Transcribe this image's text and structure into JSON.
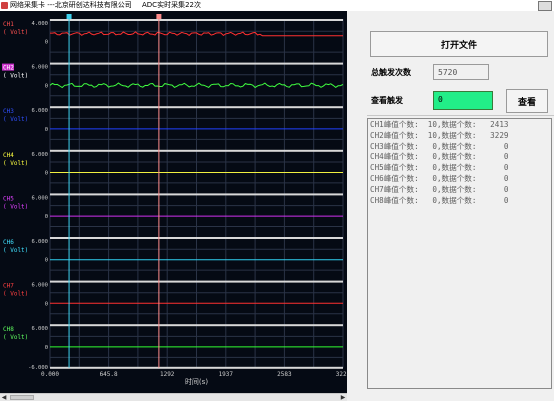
{
  "window": {
    "title": "网络采集卡 ---北京研创达科技有限公司",
    "subtitle": "ADC实时采集22次"
  },
  "chart_data": {
    "type": "line",
    "xlabel": "时间(s)",
    "xlim": [
      0.0,
      3229
    ],
    "x_ticks": [
      "0.000",
      "645.8",
      "1292",
      "1937",
      "2583",
      "3229"
    ],
    "cursors": [
      {
        "color": "#3fd3f0",
        "x": 210
      },
      {
        "color": "#ff8c8c",
        "x": 1200
      }
    ],
    "grid": true,
    "channels": [
      {
        "name": "CH1",
        "unit": "( Volt)",
        "name_color": "#ff5050",
        "unit_color": "#ff5050",
        "line_color": "#ff3030",
        "ymax": "4.000",
        "ymin": "",
        "trace": "noise_then_flat"
      },
      {
        "name": "CH2",
        "unit": "( Volt)",
        "name_color": "#ffffff",
        "name_bg": "#cc33cc",
        "unit_color": "#ffffff",
        "line_color": "#40ff40",
        "ymax": "6.000",
        "ymin": "",
        "trace": "noise"
      },
      {
        "name": "CH3",
        "unit": "( Volt)",
        "name_color": "#3050ff",
        "unit_color": "#3050ff",
        "line_color": "#2040ff",
        "ymax": "6.000",
        "ymin": "",
        "trace": "flat"
      },
      {
        "name": "CH4",
        "unit": "( Volt)",
        "name_color": "#ffff40",
        "unit_color": "#ffff40",
        "line_color": "#f0f040",
        "ymax": "6.000",
        "ymin": "",
        "trace": "flat"
      },
      {
        "name": "CH5",
        "unit": "( Volt)",
        "name_color": "#e040ff",
        "unit_color": "#e040ff",
        "line_color": "#d030f0",
        "ymax": "6.000",
        "ymin": "",
        "trace": "flat"
      },
      {
        "name": "CH6",
        "unit": "( Volt)",
        "name_color": "#40e0ff",
        "unit_color": "#40e0ff",
        "line_color": "#30d0f0",
        "ymax": "6.000",
        "ymin": "",
        "trace": "flat"
      },
      {
        "name": "CH7",
        "unit": "( Volt)",
        "name_color": "#ff4040",
        "unit_color": "#ff4040",
        "line_color": "#ff3030",
        "ymax": "6.000",
        "ymin": "",
        "trace": "flat"
      },
      {
        "name": "CH8",
        "unit": "( Volt)",
        "name_color": "#60ff60",
        "unit_color": "#60ff60",
        "line_color": "#30ff30",
        "ymax": "6.000",
        "ymin": "-6.000",
        "trace": "flat"
      }
    ]
  },
  "controls": {
    "open_file_label": "打开文件",
    "total_triggers_label": "总触发次数",
    "total_triggers_value": "5720",
    "view_trigger_label": "查看触发",
    "view_trigger_value": "0",
    "view_button_label": "查看"
  },
  "results": [
    "CH1峰值个数:  10,数据个数:   2413",
    "CH2峰值个数:  10,数据个数:   3229",
    "CH3峰值个数:   0,数据个数:      0",
    "CH4峰值个数:   0,数据个数:      0",
    "CH5峰值个数:   0,数据个数:      0",
    "CH6峰值个数:   0,数据个数:      0",
    "CH7峰值个数:   0,数据个数:      0",
    "CH8峰值个数:   0,数据个数:      0"
  ]
}
